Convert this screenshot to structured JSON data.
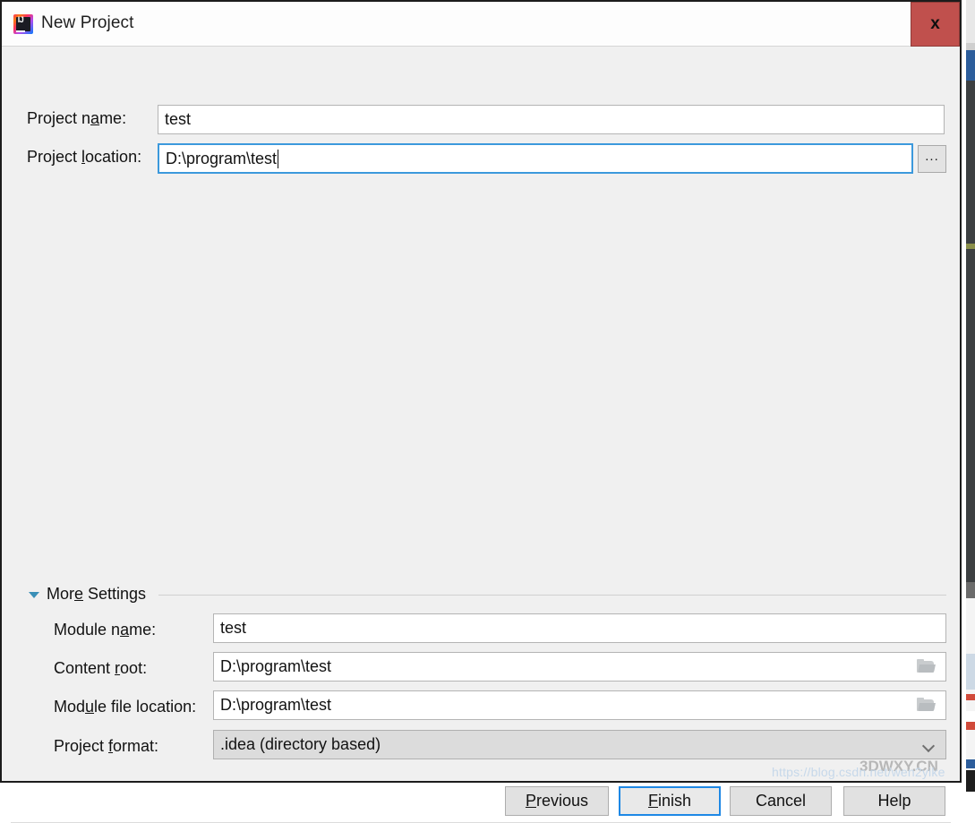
{
  "window": {
    "title": "New Project",
    "app_icon": "intellij-idea-icon",
    "icon_letters": "IJ",
    "close_label": "x"
  },
  "fields": {
    "project_name": {
      "label_pre": "Project n",
      "label_mnemonic": "a",
      "label_post": "me:",
      "value": "test"
    },
    "project_location": {
      "label_pre": "Project ",
      "label_mnemonic": "l",
      "label_post": "ocation:",
      "value": "D:\\program\\test",
      "browse_label": "..."
    }
  },
  "more_settings": {
    "label_pre": "Mor",
    "label_mnemonic": "e",
    "label_post": " Settings",
    "expanded": true,
    "rows": [
      {
        "name": "module-name",
        "label_pre": "Module n",
        "label_mnemonic": "a",
        "label_post": "me:",
        "value": "test",
        "has_folder_icon": false,
        "type": "text"
      },
      {
        "name": "content-root",
        "label_pre": "Content ",
        "label_mnemonic": "r",
        "label_post": "oot:",
        "value": "D:\\program\\test",
        "has_folder_icon": true,
        "type": "text"
      },
      {
        "name": "module-file-location",
        "label_pre": "Mod",
        "label_mnemonic": "u",
        "label_post": "le file location:",
        "value": "D:\\program\\test",
        "has_folder_icon": true,
        "type": "text"
      },
      {
        "name": "project-format",
        "label_pre": "Project ",
        "label_mnemonic": "f",
        "label_post": "ormat:",
        "value": ".idea (directory based)",
        "has_folder_icon": false,
        "type": "combobox"
      }
    ]
  },
  "buttons": [
    {
      "name": "previous",
      "pre": "",
      "mnemonic": "P",
      "post": "revious",
      "default": false
    },
    {
      "name": "finish",
      "pre": "",
      "mnemonic": "F",
      "post": "inish",
      "default": true
    },
    {
      "name": "cancel",
      "pre": "Cancel",
      "mnemonic": "",
      "post": "",
      "default": false
    },
    {
      "name": "help",
      "pre": "Help",
      "mnemonic": "",
      "post": "",
      "default": false
    }
  ],
  "watermark": {
    "url": "https://blog.csdn.net/wen2yike",
    "brand": "3DWXY.CN"
  },
  "colors": {
    "accent_blue": "#3c99dc",
    "default_button_border": "#1e88e5",
    "close_red": "#c0504d",
    "dialog_bg": "#f0f0f0",
    "titlebar_bg": "#fdfdfd",
    "triangle_blue": "#3a8fb7"
  }
}
